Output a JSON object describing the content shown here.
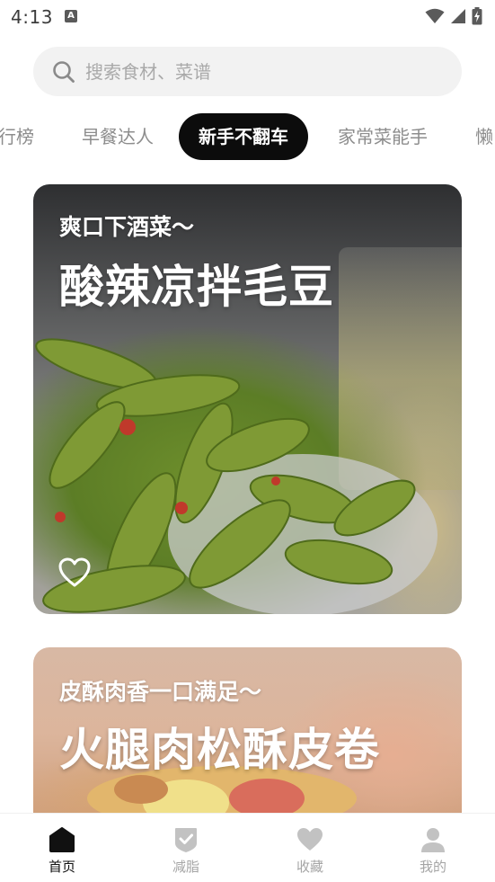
{
  "status_bar": {
    "time": "4:13",
    "notification_badge": "A"
  },
  "search": {
    "placeholder": "搜索食材、菜谱"
  },
  "tabs": [
    {
      "label": "行榜",
      "active": false
    },
    {
      "label": "早餐达人",
      "active": false
    },
    {
      "label": "新手不翻车",
      "active": true
    },
    {
      "label": "家常菜能手",
      "active": false
    },
    {
      "label": "懒",
      "active": false
    }
  ],
  "cards": [
    {
      "subtitle": "爽口下酒菜～",
      "title": "酸辣凉拌毛豆",
      "favorite_icon": "heart-outline-icon"
    },
    {
      "subtitle": "皮酥肉香一口满足～",
      "title": "火腿肉松酥皮卷"
    }
  ],
  "bottom_nav": [
    {
      "label": "首页",
      "icon": "home-icon",
      "active": true
    },
    {
      "label": "减脂",
      "icon": "check-shield-icon",
      "active": false
    },
    {
      "label": "收藏",
      "icon": "heart-icon",
      "active": false
    },
    {
      "label": "我的",
      "icon": "person-icon",
      "active": false
    }
  ],
  "colors": {
    "active_tab_bg": "#0c0c0c",
    "inactive_text": "#8d8d8d",
    "search_bg": "#f2f2f2",
    "nav_active": "#111111",
    "nav_inactive": "#a5a5a5"
  }
}
